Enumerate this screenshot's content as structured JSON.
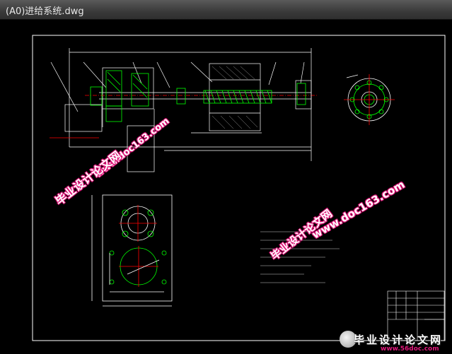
{
  "window": {
    "title": "(A0)进给系统.dwg"
  },
  "watermarks": {
    "cn_text": "毕业设计论文网",
    "url_text": "www.doc163.com"
  },
  "corner_logo": {
    "cn_text": "毕业设计论文网",
    "url_text": "www.56doc.com"
  },
  "colors": {
    "background": "#000000",
    "lines": "#ffffff",
    "green_parts": "#00ff00",
    "red_centerlines": "#ff0000",
    "watermark_outline": "#e0177a"
  }
}
